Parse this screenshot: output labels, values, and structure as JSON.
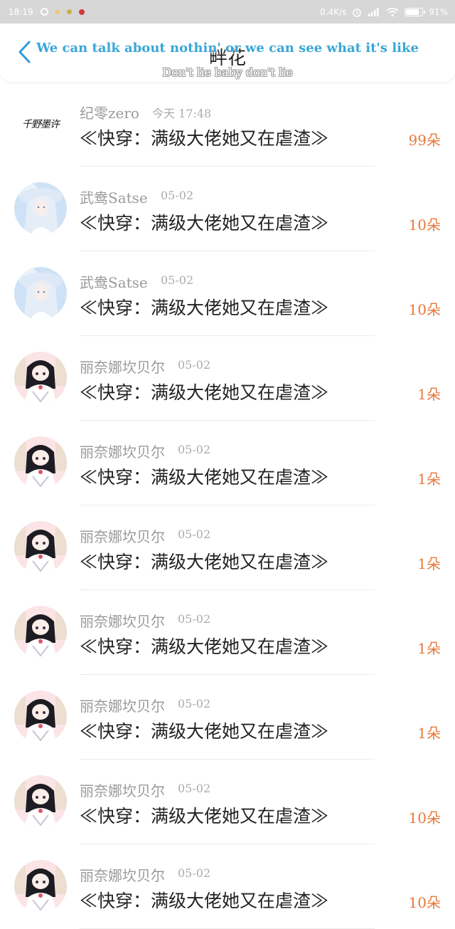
{
  "status_bar": {
    "time": "18:19",
    "network_speed": "0.4K/s",
    "battery": "91%",
    "battery_level": 0.91
  },
  "header": {
    "title": "畔花",
    "lyric_line_1": "We can talk about nothin' or we can see what it's like",
    "lyric_line_2": "Don't lie baby don't lie",
    "back_icon": "chevron-left-icon",
    "accent_color": "#2f9be0"
  },
  "colors": {
    "count_color": "#e8773a",
    "name_color": "#9a9a9a"
  },
  "list": [
    {
      "avatar": "signature",
      "avatar_text": "千野墨许",
      "name": "纪零zero",
      "time": "今天 17:48",
      "title": "≪快穿：满级大佬她又在虐渣≫",
      "count": "99朵"
    },
    {
      "avatar": "blue-girl",
      "avatar_text": "",
      "name": "武鸯Satse",
      "time": "05-02",
      "title": "≪快穿：满级大佬她又在虐渣≫",
      "count": "10朵"
    },
    {
      "avatar": "blue-girl",
      "avatar_text": "",
      "name": "武鸯Satse",
      "time": "05-02",
      "title": "≪快穿：满级大佬她又在虐渣≫",
      "count": "10朵"
    },
    {
      "avatar": "chibi-girl",
      "avatar_text": "",
      "name": "丽奈娜坎贝尔",
      "time": "05-02",
      "title": "≪快穿：满级大佬她又在虐渣≫",
      "count": "1朵"
    },
    {
      "avatar": "chibi-girl",
      "avatar_text": "",
      "name": "丽奈娜坎贝尔",
      "time": "05-02",
      "title": "≪快穿：满级大佬她又在虐渣≫",
      "count": "1朵"
    },
    {
      "avatar": "chibi-girl",
      "avatar_text": "",
      "name": "丽奈娜坎贝尔",
      "time": "05-02",
      "title": "≪快穿：满级大佬她又在虐渣≫",
      "count": "1朵"
    },
    {
      "avatar": "chibi-girl",
      "avatar_text": "",
      "name": "丽奈娜坎贝尔",
      "time": "05-02",
      "title": "≪快穿：满级大佬她又在虐渣≫",
      "count": "1朵"
    },
    {
      "avatar": "chibi-girl",
      "avatar_text": "",
      "name": "丽奈娜坎贝尔",
      "time": "05-02",
      "title": "≪快穿：满级大佬她又在虐渣≫",
      "count": "1朵"
    },
    {
      "avatar": "chibi-girl",
      "avatar_text": "",
      "name": "丽奈娜坎贝尔",
      "time": "05-02",
      "title": "≪快穿：满级大佬她又在虐渣≫",
      "count": "10朵"
    },
    {
      "avatar": "chibi-girl",
      "avatar_text": "",
      "name": "丽奈娜坎贝尔",
      "time": "05-02",
      "title": "≪快穿：满级大佬她又在虐渣≫",
      "count": "10朵"
    }
  ]
}
